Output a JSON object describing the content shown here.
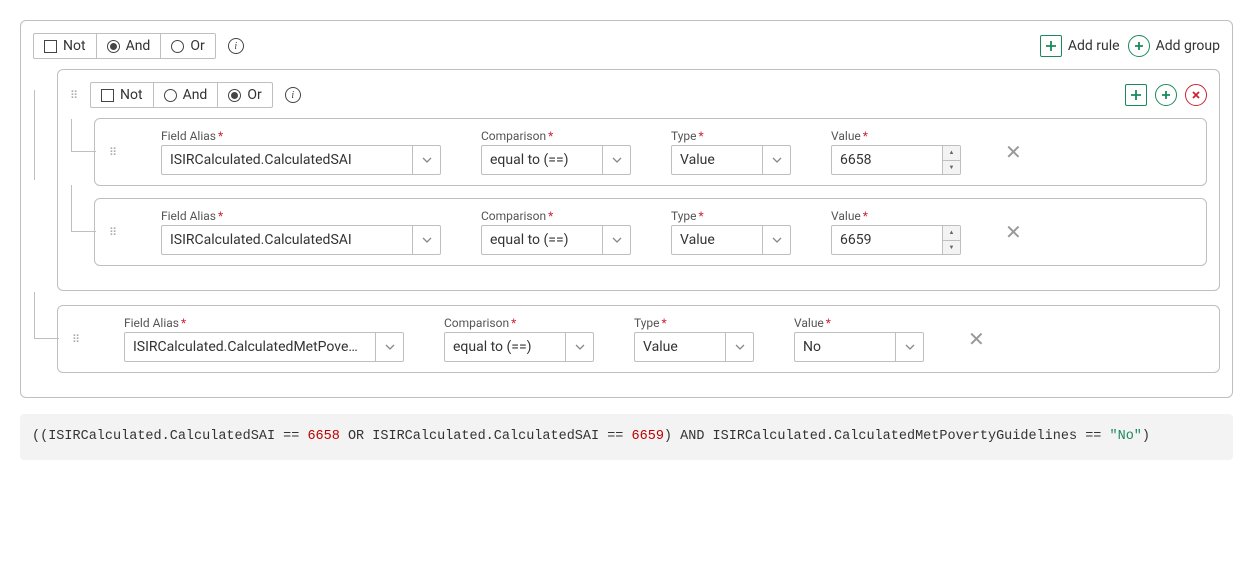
{
  "labels": {
    "not": "Not",
    "and": "And",
    "or": "Or",
    "addRule": "Add rule",
    "addGroup": "Add group",
    "fieldAlias": "Field Alias",
    "comparison": "Comparison",
    "type": "Type",
    "value": "Value",
    "info": "i"
  },
  "rootGroup": {
    "not": false,
    "logic": "and",
    "children": [
      {
        "kind": "group",
        "not": false,
        "logic": "or",
        "children": [
          {
            "kind": "rule",
            "alias": "ISIRCalculated.CalculatedSAI",
            "comparison": "equal to (==)",
            "type": "Value",
            "value": "6658",
            "valueKind": "number"
          },
          {
            "kind": "rule",
            "alias": "ISIRCalculated.CalculatedSAI",
            "comparison": "equal to (==)",
            "type": "Value",
            "value": "6659",
            "valueKind": "number"
          }
        ]
      },
      {
        "kind": "rule",
        "alias": "ISIRCalculated.CalculatedMetPove…",
        "comparison": "equal to (==)",
        "type": "Value",
        "value": "No",
        "valueKind": "select"
      }
    ]
  },
  "expression": {
    "parts": [
      {
        "t": "txt",
        "v": "((ISIRCalculated.CalculatedSAI == "
      },
      {
        "t": "num",
        "v": "6658"
      },
      {
        "t": "txt",
        "v": " OR ISIRCalculated.CalculatedSAI == "
      },
      {
        "t": "num",
        "v": "6659"
      },
      {
        "t": "txt",
        "v": ") AND ISIRCalculated.CalculatedMetPovertyGuidelines == "
      },
      {
        "t": "str",
        "v": "\"No\""
      },
      {
        "t": "txt",
        "v": ")"
      }
    ]
  }
}
